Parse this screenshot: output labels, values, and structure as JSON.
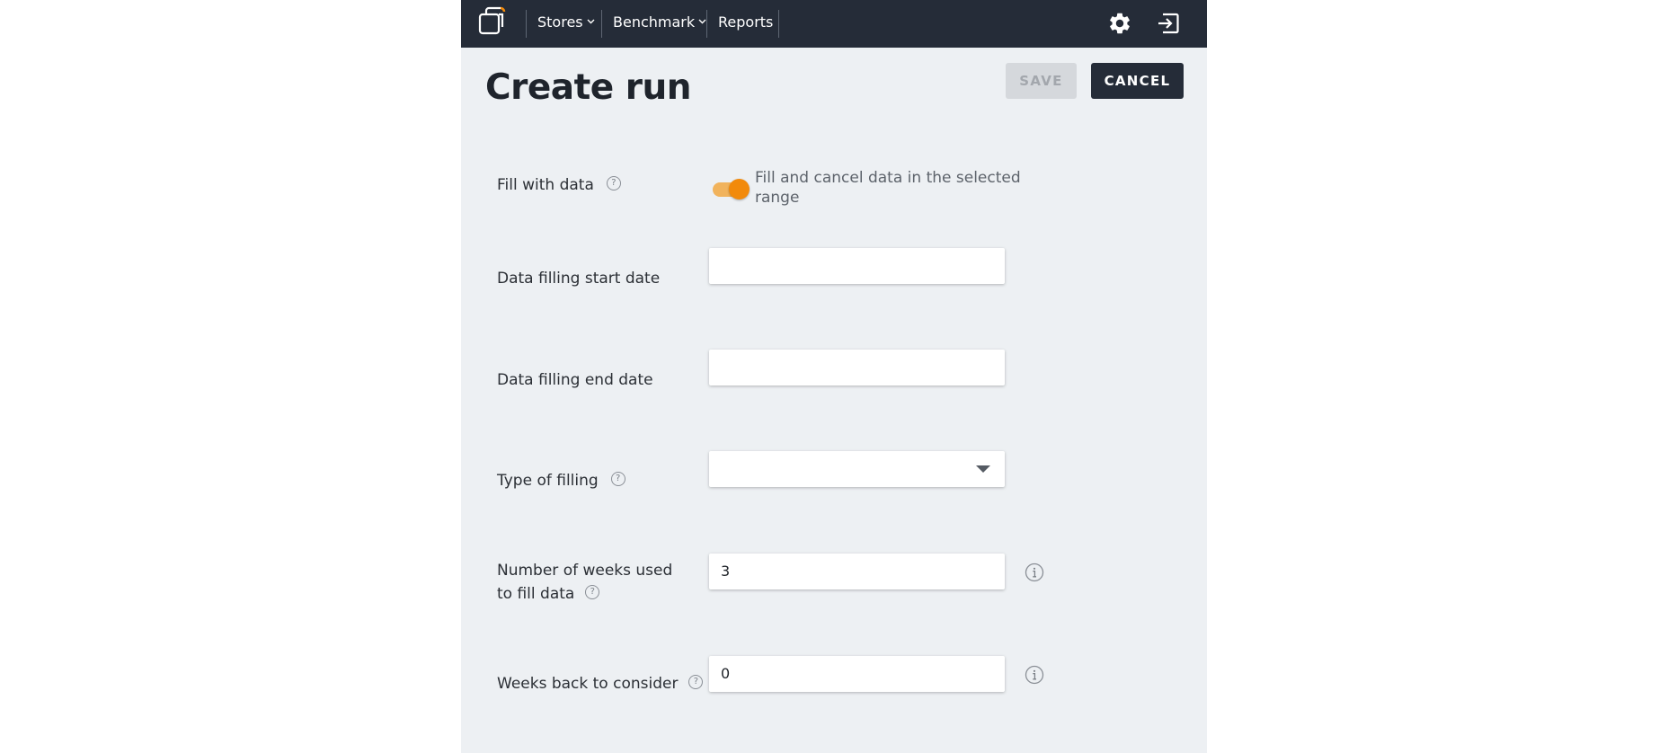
{
  "nav": {
    "items": [
      {
        "label": "Stores",
        "has_dropdown": true
      },
      {
        "label": "Benchmark",
        "has_dropdown": true
      },
      {
        "label": "Reports",
        "has_dropdown": false
      }
    ],
    "icons": [
      "logo-icon",
      "gear-icon",
      "logout-icon"
    ]
  },
  "page": {
    "title": "Create run",
    "save_label": "SAVE",
    "cancel_label": "CANCEL"
  },
  "form": {
    "fill_with_data": {
      "label": "Fill with data",
      "enabled": true,
      "description": "Fill and cancel data in the selected range"
    },
    "start_date": {
      "label": "Data filling start date",
      "value": ""
    },
    "end_date": {
      "label": "Data filling end date",
      "value": ""
    },
    "type_of_filling": {
      "label": "Type of filling",
      "value": ""
    },
    "weeks_used": {
      "label": "Number of weeks used to fill data",
      "value": "3"
    },
    "weeks_back": {
      "label": "Weeks back to consider",
      "value": "0"
    }
  },
  "colors": {
    "topbar": "#252c38",
    "accent": "#f28a0b",
    "background": "#edf0f3"
  }
}
